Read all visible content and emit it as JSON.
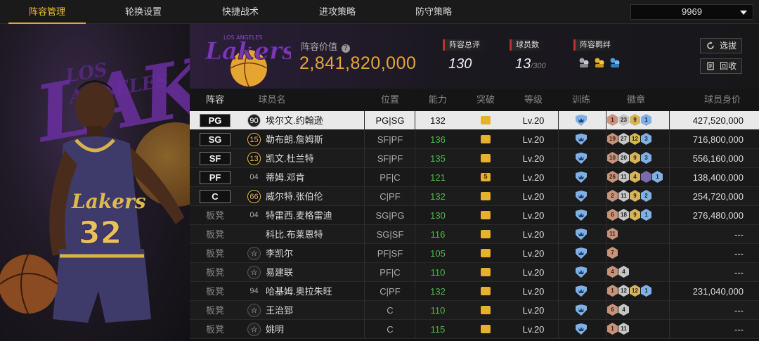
{
  "tabs": [
    "阵容管理",
    "轮换设置",
    "快捷战术",
    "进攻策略",
    "防守策略"
  ],
  "search": {
    "value": "9969"
  },
  "team": {
    "value_label": "阵容价值",
    "value": "2,841,820,000",
    "rating_label": "阵容总评",
    "rating": "130",
    "players_label": "球员数",
    "players": "13",
    "players_max": "/300",
    "bond_label": "阵容羁绊",
    "logo_text": "Lakers",
    "logo_top": "LOS ANGELES"
  },
  "buttons": {
    "select": "选拔",
    "recycle": "回收"
  },
  "columns": [
    "阵容",
    "球员名",
    "位置",
    "能力",
    "突破",
    "等级",
    "训练",
    "徽章",
    "球员身价"
  ],
  "colors": {
    "accent": "#e0ab2a",
    "green": "#4fb84a",
    "gold_value": "#e3a53a"
  },
  "rows": [
    {
      "pos": "PG",
      "starter": true,
      "num": "90",
      "num_style": "black",
      "name": "埃尔文.约翰逊",
      "position": "PG|SG",
      "ability": "132",
      "ability_color": "default",
      "breakthrough": "",
      "level": "Lv.20",
      "badges": [
        [
          "b",
          "1"
        ],
        [
          "s",
          "23"
        ],
        [
          "g",
          "9"
        ],
        [
          "l",
          "1"
        ]
      ],
      "value": "427,520,000",
      "selected": true
    },
    {
      "pos": "SG",
      "starter": true,
      "num": "15",
      "num_style": "gold",
      "name": "勒布朗.詹姆斯",
      "position": "SF|PF",
      "ability": "136",
      "ability_color": "green",
      "breakthrough": "",
      "level": "Lv.20",
      "badges": [
        [
          "b",
          "19"
        ],
        [
          "s",
          "27"
        ],
        [
          "g",
          "12"
        ],
        [
          "l",
          "3"
        ]
      ],
      "value": "716,800,000"
    },
    {
      "pos": "SF",
      "starter": true,
      "num": "13",
      "num_style": "gold",
      "name": "凯文.杜兰特",
      "position": "SF|PF",
      "ability": "135",
      "ability_color": "green",
      "breakthrough": "",
      "level": "Lv.20",
      "badges": [
        [
          "b",
          "10"
        ],
        [
          "s",
          "20"
        ],
        [
          "g",
          "9"
        ],
        [
          "l",
          "3"
        ]
      ],
      "value": "556,160,000"
    },
    {
      "pos": "PF",
      "starter": true,
      "num": "04",
      "num_style": "plain",
      "name": "蒂姆.邓肯",
      "position": "PF|C",
      "ability": "121",
      "ability_color": "green",
      "breakthrough": "5",
      "level": "Lv.20",
      "badges": [
        [
          "b",
          "26"
        ],
        [
          "s",
          "11"
        ],
        [
          "g",
          "4"
        ],
        [
          "p",
          ""
        ],
        [
          "l",
          "1"
        ]
      ],
      "value": "138,400,000"
    },
    {
      "pos": "C",
      "starter": true,
      "num": "66",
      "num_style": "gold",
      "name": "威尔特.张伯伦",
      "position": "C|PF",
      "ability": "132",
      "ability_color": "green",
      "breakthrough": "",
      "level": "Lv.20",
      "badges": [
        [
          "b",
          "2"
        ],
        [
          "s",
          "11"
        ],
        [
          "g",
          "9"
        ],
        [
          "l",
          "2"
        ]
      ],
      "value": "254,720,000"
    },
    {
      "pos": "板凳",
      "starter": false,
      "num": "04",
      "num_style": "plain",
      "name": "特雷西.麦格雷迪",
      "position": "SG|PG",
      "ability": "130",
      "ability_color": "green",
      "breakthrough": "",
      "level": "Lv.20",
      "badges": [
        [
          "b",
          "6"
        ],
        [
          "s",
          "18"
        ],
        [
          "g",
          "9"
        ],
        [
          "l",
          "1"
        ]
      ],
      "value": "276,480,000"
    },
    {
      "pos": "板凳",
      "starter": false,
      "num": "",
      "num_style": "plain",
      "name": "科比.布莱恩特",
      "position": "SG|SF",
      "ability": "116",
      "ability_color": "green",
      "breakthrough": "",
      "level": "Lv.20",
      "badges": [
        [
          "b",
          "11"
        ]
      ],
      "value": "---"
    },
    {
      "pos": "板凳",
      "starter": false,
      "num": "☆",
      "num_style": "dark",
      "name": "李凯尔",
      "position": "PF|SF",
      "ability": "105",
      "ability_color": "green",
      "breakthrough": "",
      "level": "Lv.20",
      "badges": [
        [
          "b",
          "7"
        ]
      ],
      "value": "---"
    },
    {
      "pos": "板凳",
      "starter": false,
      "num": "☆",
      "num_style": "dark",
      "name": "易建联",
      "position": "PF|C",
      "ability": "110",
      "ability_color": "green",
      "breakthrough": "",
      "level": "Lv.20",
      "badges": [
        [
          "b",
          "4"
        ],
        [
          "s",
          "4"
        ]
      ],
      "value": "---"
    },
    {
      "pos": "板凳",
      "starter": false,
      "num": "94",
      "num_style": "plain",
      "name": "哈基姆.奥拉朱旺",
      "position": "C|PF",
      "ability": "132",
      "ability_color": "green",
      "breakthrough": "",
      "level": "Lv.20",
      "badges": [
        [
          "b",
          "1"
        ],
        [
          "s",
          "12"
        ],
        [
          "g",
          "12"
        ],
        [
          "l",
          "1"
        ]
      ],
      "value": "231,040,000"
    },
    {
      "pos": "板凳",
      "starter": false,
      "num": "☆",
      "num_style": "dark",
      "name": "王治郅",
      "position": "C",
      "ability": "110",
      "ability_color": "green",
      "breakthrough": "",
      "level": "Lv.20",
      "badges": [
        [
          "b",
          "6"
        ],
        [
          "s",
          "4"
        ]
      ],
      "value": "---"
    },
    {
      "pos": "板凳",
      "starter": false,
      "num": "☆",
      "num_style": "dark",
      "name": "姚明",
      "position": "C",
      "ability": "115",
      "ability_color": "green",
      "breakthrough": "",
      "level": "Lv.20",
      "badges": [
        [
          "b",
          "1"
        ],
        [
          "s",
          "11"
        ]
      ],
      "value": "---"
    }
  ]
}
